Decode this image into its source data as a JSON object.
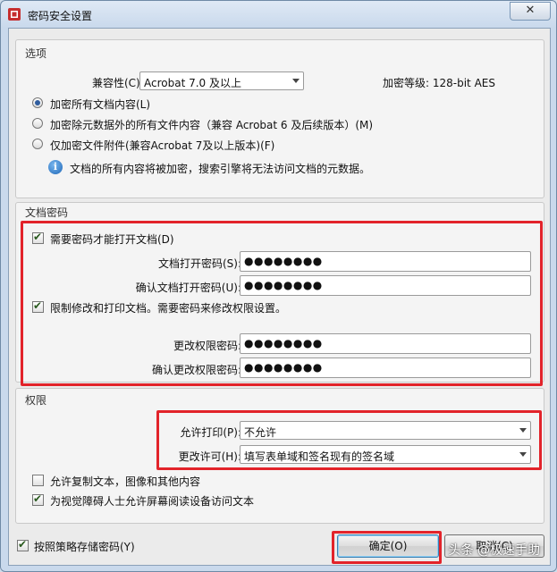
{
  "window": {
    "title": "密码安全设置",
    "close_glyph": "✕"
  },
  "options": {
    "title": "选项",
    "compat_label": "兼容性(C):",
    "compat_value": "Acrobat 7.0 及以上",
    "encrypt_level": "加密等级: 128-bit AES",
    "radios": [
      {
        "label": "加密所有文档内容(L)",
        "selected": true
      },
      {
        "label": "加密除元数据外的所有文件内容（兼容 Acrobat 6 及后续版本）(M)",
        "selected": false
      },
      {
        "label": "仅加密文件附件(兼容Acrobat 7及以上版本)(F)",
        "selected": false
      }
    ],
    "info_glyph": "i",
    "info_text": "文档的所有内容将被加密，搜索引擎将无法访问文档的元数据。"
  },
  "doc_password": {
    "title": "文档密码",
    "require_open_label": "需要密码才能打开文档(D)",
    "open_pwd_label": "文档打开密码(S):",
    "open_pwd_value": "●●●●●●●●",
    "confirm_open_label": "确认文档打开密码(U):",
    "confirm_open_value": "●●●●●●●●",
    "restrict_label": "限制修改和打印文档。需要密码来修改权限设置。",
    "perm_pwd_label": "更改权限密码:",
    "perm_pwd_value": "●●●●●●●●",
    "confirm_perm_label": "确认更改权限密码:",
    "confirm_perm_value": "●●●●●●●●"
  },
  "permissions": {
    "title": "权限",
    "print_label": "允许打印(P):",
    "print_value": "不允许",
    "change_label": "更改许可(H):",
    "change_value": "填写表单域和签名现有的签名域",
    "copy_label": "允许复制文本，图像和其他内容",
    "screen_reader_label": "为视觉障碍人士允许屏幕阅读设备访问文本"
  },
  "footer": {
    "store_label": "按照策略存储密码(Y)",
    "ok_label": "确定(O)",
    "cancel_label": "取消(C)",
    "watermark": "头条 @极速手助"
  },
  "colors": {
    "highlight": "#e2232a",
    "radio_dot": "#2f5d9e"
  }
}
